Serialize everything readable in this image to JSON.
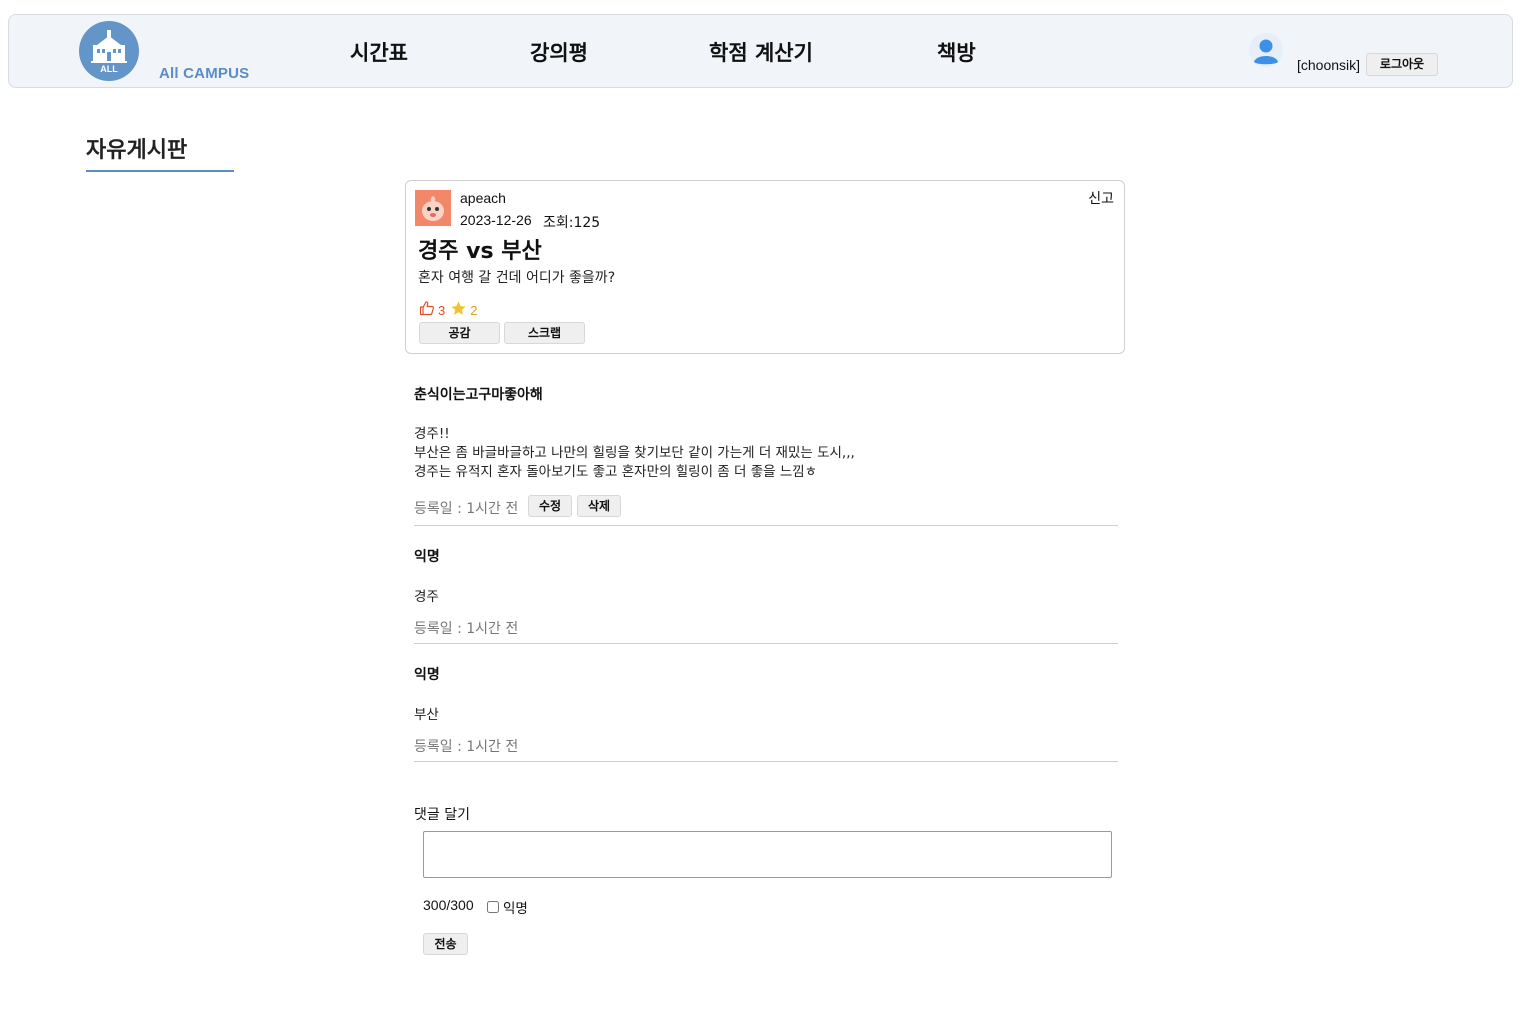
{
  "header": {
    "logo_text": "ALL",
    "brand": "All CAMPUS",
    "nav": [
      {
        "label": "시간표"
      },
      {
        "label": "강의평"
      },
      {
        "label": "학점 계산기"
      },
      {
        "label": "책방"
      }
    ],
    "username": "[choonsik]",
    "logout_label": "로그아웃"
  },
  "board": {
    "title": "자유게시판"
  },
  "post": {
    "author": "apeach",
    "date": "2023-12-26",
    "views": "조회:125",
    "report_label": "신고",
    "title": "경주 vs 부산",
    "body": "혼자 여행 갈 건데 어디가 좋을까?",
    "likes": "3",
    "scraps": "2",
    "like_button": "공감",
    "scrap_button": "스크랩"
  },
  "comments": [
    {
      "author": "춘식이는고구마좋아해",
      "lines": [
        "경주!!",
        "부산은 좀 바글바글하고 나만의 힐링을 찾기보단 같이 가는게 더 재밌는 도시,,,",
        "경주는 유적지 혼자 돌아보기도 좋고 혼자만의 힐링이 좀 더 좋을 느낌ㅎ"
      ],
      "date": "등록일 : 1시간 전",
      "edit_label": "수정",
      "delete_label": "삭제"
    },
    {
      "author": "익명",
      "lines": [
        "경주"
      ],
      "date": "등록일 : 1시간 전"
    },
    {
      "author": "익명",
      "lines": [
        "부산"
      ],
      "date": "등록일 : 1시간 전"
    }
  ],
  "comment_form": {
    "label": "댓글 달기",
    "value": "",
    "counter": "300/300",
    "anonymous_label": "익명",
    "submit_label": "전송"
  },
  "colors": {
    "accent": "#5b8cc4",
    "header_bg": "#f1f5fa",
    "like": "#e04f2d",
    "scrap": "#e0a020"
  }
}
